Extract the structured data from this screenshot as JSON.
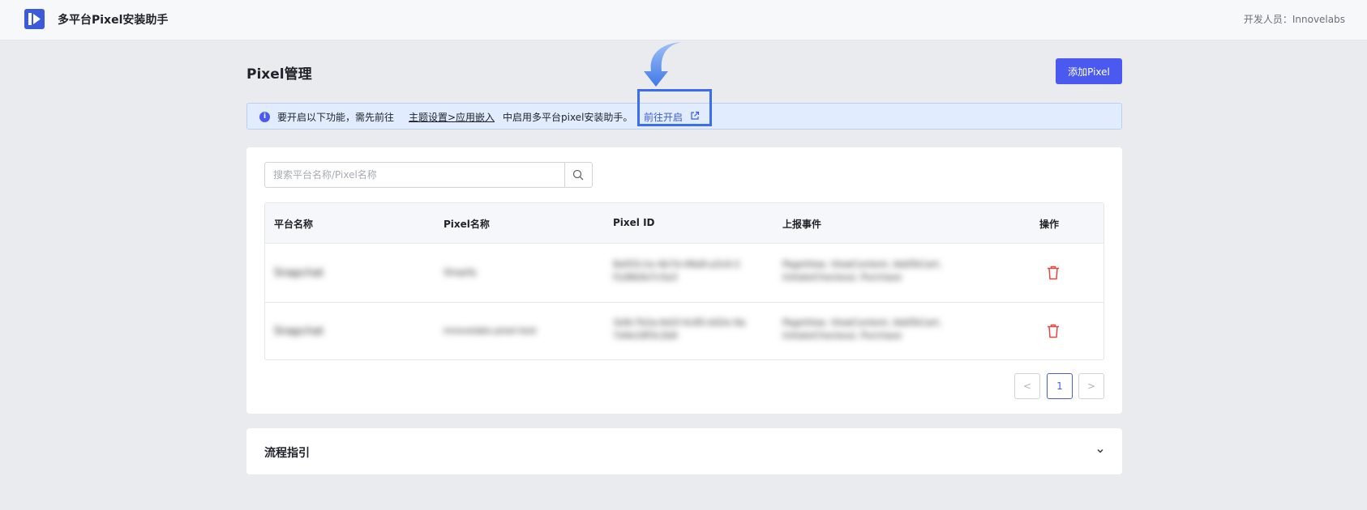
{
  "header": {
    "app_title": "多平台Pixel安装助手",
    "developer": "开发人员：Innovelabs"
  },
  "page": {
    "title": "Pixel管理",
    "add_button": "添加Pixel"
  },
  "notice": {
    "text_before": "要开启以下功能，需先前往",
    "link_theme": "主题设置>应用嵌入",
    "text_after": "中启用多平台pixel安装助手。",
    "goto_link": "前往开启"
  },
  "search": {
    "placeholder": "搜索平台名称/Pixel名称",
    "value": ""
  },
  "table": {
    "headers": [
      "平台名称",
      "Pixel名称",
      "Pixel ID",
      "上报事件",
      "操作"
    ],
    "rows": [
      {
        "platform": "Snapchat",
        "name": "Shopify",
        "pixel_id": "8a5f2c1e-4b7d-49e8-a3c6-2",
        "pixel_id_2": "f1d9b0e7c5a3",
        "events": "PageView, ViewContent, AddToCart,",
        "events_2": "InitiateCheckout, Purchase"
      },
      {
        "platform": "Snapchat",
        "name": "innovelabs-pixel-test",
        "pixel_id": "3e9c7b2a-6d1f-4c85-b02e-9a",
        "pixel_id_2": "7d4e18f3c2b6",
        "events": "PageView, ViewContent, AddToCart,",
        "events_2": "InitiateCheckout, Purchase"
      }
    ]
  },
  "pagination": {
    "prev": "<",
    "current": "1",
    "next": ">"
  },
  "guide": {
    "title": "流程指引"
  },
  "colors": {
    "primary": "#4a5af0",
    "notice_bg": "#e1ecff",
    "delete": "#e5473d",
    "highlight_box": "#3b6df0"
  },
  "icons": [
    "logo-icon",
    "info-icon",
    "external-link-icon",
    "search-icon",
    "trash-icon",
    "chevron-down-icon",
    "arrow-down-icon"
  ]
}
